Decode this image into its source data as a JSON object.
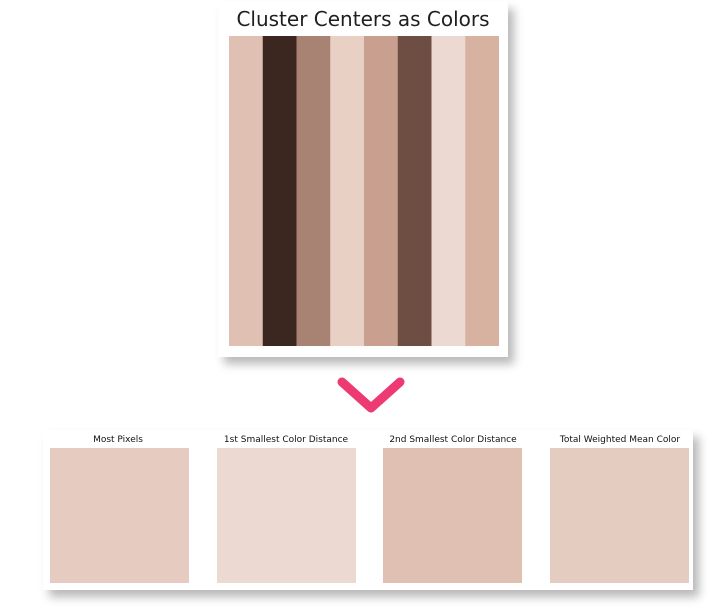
{
  "top": {
    "title": "Cluster Centers as Colors",
    "cluster_colors": [
      "#e0c0b3",
      "#3c2620",
      "#a88272",
      "#e8d0c5",
      "#c9a090",
      "#6e4e42",
      "#ecdad2",
      "#d7b2a1"
    ]
  },
  "arrow_color": "#ee3a72",
  "panels": [
    {
      "title": "Most Pixels",
      "color": "#e6cbc0"
    },
    {
      "title": "1st Smallest Color Distance",
      "color": "#ecdad2"
    },
    {
      "title": "2nd Smallest Color Distance",
      "color": "#dfc0b3"
    },
    {
      "title": "Total Weighted Mean Color",
      "color": "#e5ccc0"
    }
  ]
}
